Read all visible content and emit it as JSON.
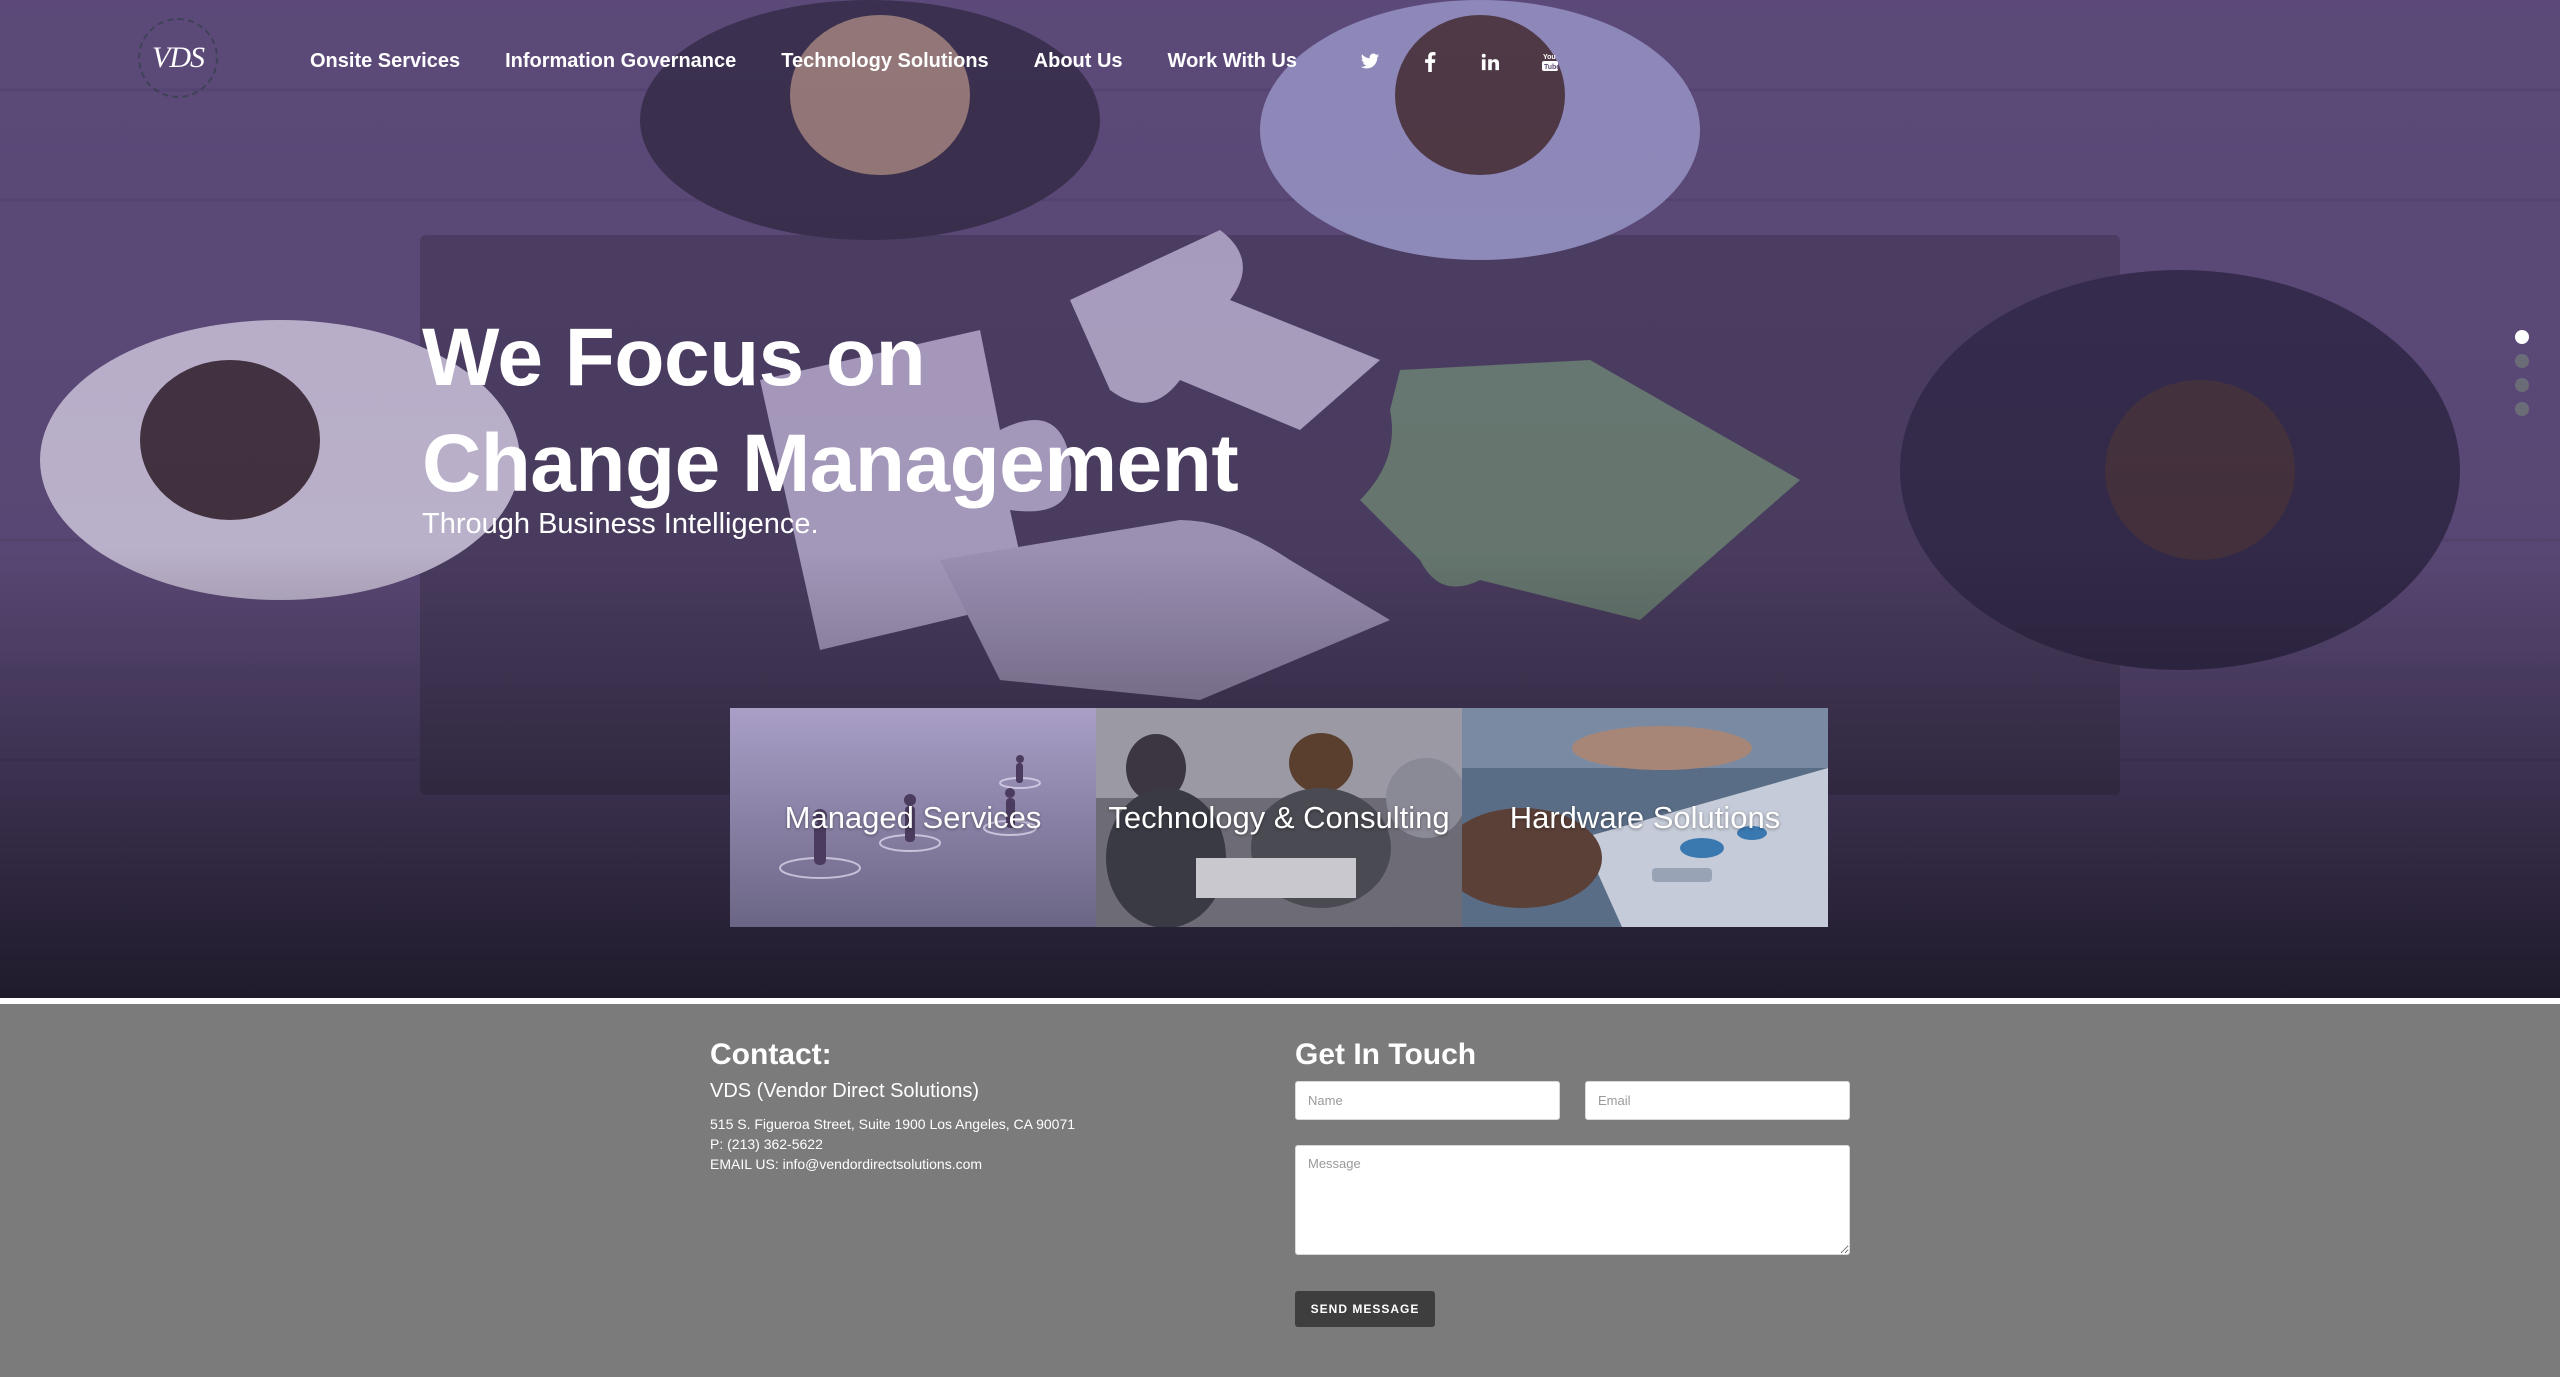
{
  "logo": {
    "text": "VDS"
  },
  "nav": {
    "items": [
      "Onsite Services",
      "Information Governance",
      "Technology Solutions",
      "About Us",
      "Work With Us"
    ]
  },
  "social": {
    "icons": [
      "twitter-icon",
      "facebook-icon",
      "linkedin-icon",
      "youtube-icon"
    ],
    "glyphs": [
      "🐦",
      "f",
      "in",
      "▶"
    ]
  },
  "hero": {
    "headline_line1": "We Focus on",
    "headline_line2": "Change Management",
    "subhead": "Through Business Intelligence.",
    "slides": 4,
    "active_slide": 0
  },
  "tiles": [
    {
      "label": "Managed Services"
    },
    {
      "label": "Technology & Consulting"
    },
    {
      "label": "Hardware Solutions"
    }
  ],
  "contact": {
    "title": "Contact:",
    "company": "VDS (Vendor Direct Solutions)",
    "address": "515 S. Figueroa Street, Suite 1900 Los Angeles, CA 90071",
    "phone": "P: (213) 362-5622",
    "email": "EMAIL US: info@vendordirectsolutions.com"
  },
  "form": {
    "title": "Get In Touch",
    "name_placeholder": "Name",
    "email_placeholder": "Email",
    "message_placeholder": "Message",
    "send_label": "SEND MESSAGE"
  },
  "colors": {
    "hero_tint": "#6c5b87",
    "footer_bg": "#7b7b7b",
    "button_bg": "#3e3e3e",
    "puzzle_green": "#6f8f6c"
  }
}
